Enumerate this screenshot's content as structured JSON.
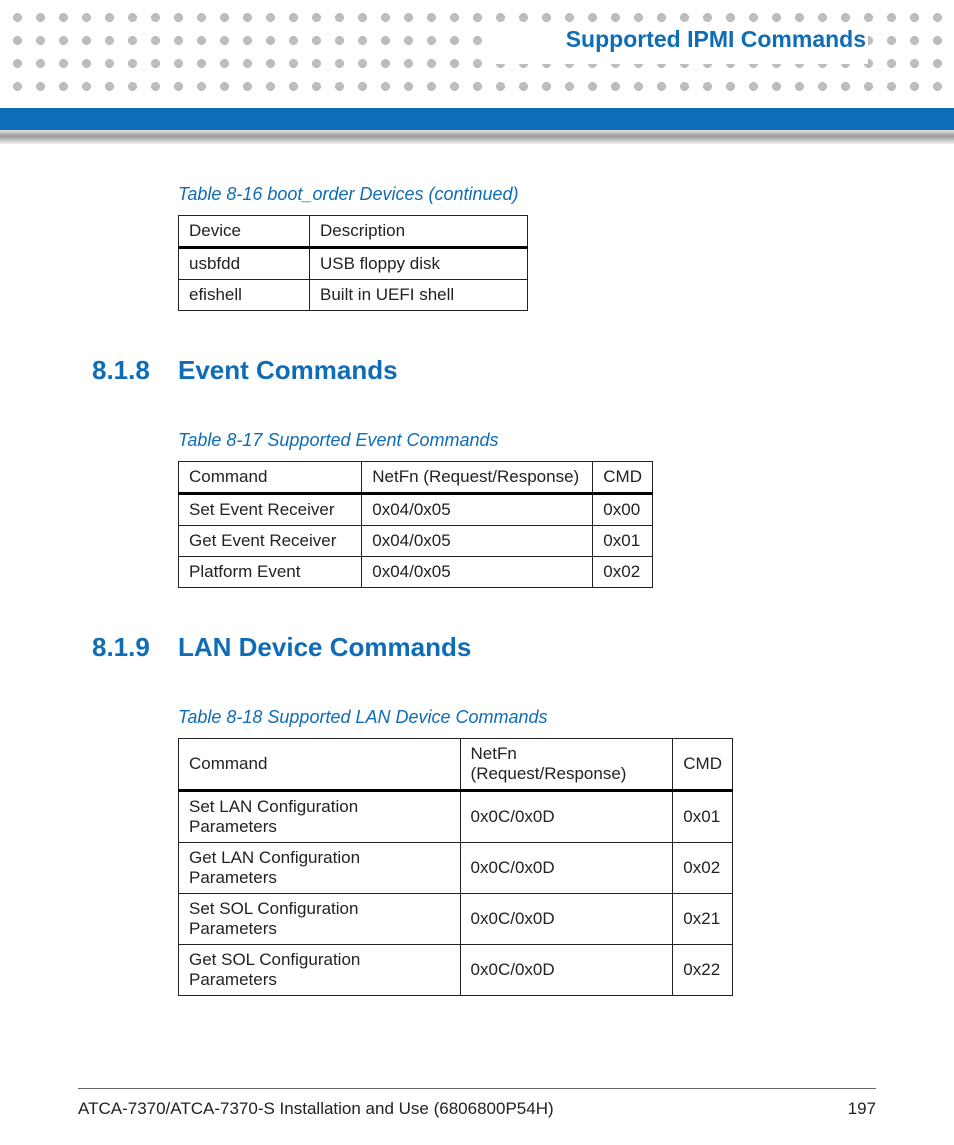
{
  "header": {
    "chapter_title": "Supported IPMI Commands"
  },
  "table16": {
    "caption": "Table 8-16 boot_order Devices (continued)",
    "headers": [
      "Device",
      "Description"
    ],
    "rows": [
      [
        "usbfdd",
        "USB floppy disk"
      ],
      [
        "efishell",
        "Built in UEFI shell"
      ]
    ]
  },
  "section818": {
    "number": "8.1.8",
    "title": "Event Commands"
  },
  "table17": {
    "caption": "Table 8-17 Supported Event Commands",
    "headers": [
      "Command",
      "NetFn (Request/Response)",
      "CMD"
    ],
    "rows": [
      [
        "Set Event Receiver",
        "0x04/0x05",
        "0x00"
      ],
      [
        "Get Event Receiver",
        "0x04/0x05",
        "0x01"
      ],
      [
        "Platform Event",
        "0x04/0x05",
        "0x02"
      ]
    ]
  },
  "section819": {
    "number": "8.1.9",
    "title": "LAN Device Commands"
  },
  "table18": {
    "caption": "Table 8-18 Supported LAN Device Commands",
    "headers": [
      "Command",
      "NetFn (Request/Response)",
      "CMD"
    ],
    "rows": [
      [
        "Set LAN Configuration Parameters",
        "0x0C/0x0D",
        "0x01"
      ],
      [
        "Get LAN Configuration Parameters",
        "0x0C/0x0D",
        "0x02"
      ],
      [
        "Set SOL Configuration Parameters",
        "0x0C/0x0D",
        "0x21"
      ],
      [
        "Get SOL Configuration Parameters",
        "0x0C/0x0D",
        "0x22"
      ]
    ]
  },
  "footer": {
    "doc_title": "ATCA-7370/ATCA-7370-S Installation and Use (6806800P54H)",
    "page": "197"
  }
}
